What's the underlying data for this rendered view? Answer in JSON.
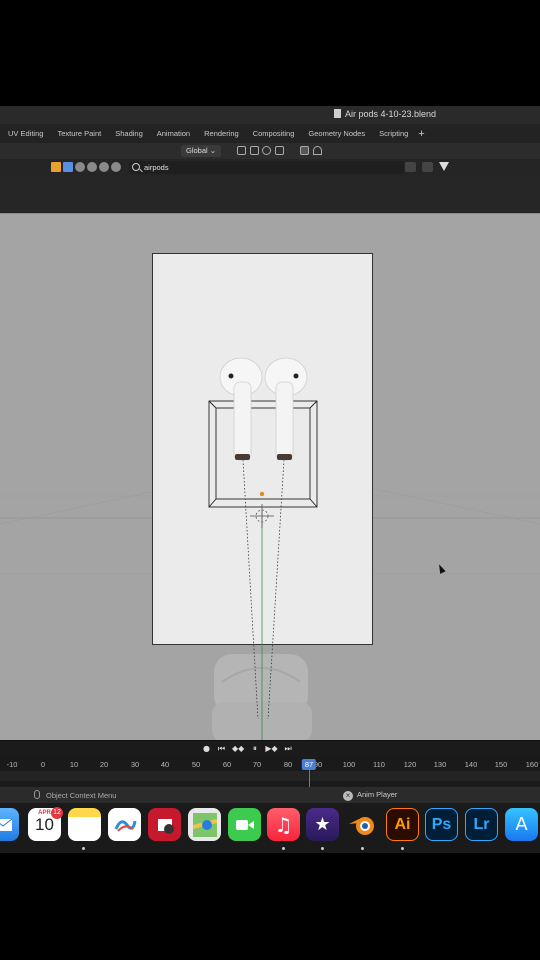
{
  "window": {
    "title": "Air pods 4-10-23.blend"
  },
  "workspaces": [
    "UV Editing",
    "Texture Paint",
    "Shading",
    "Animation",
    "Rendering",
    "Compositing",
    "Geometry Nodes",
    "Scripting"
  ],
  "workspace_add": "+",
  "header": {
    "transform_orientation": "Global ⌄"
  },
  "outliner": {
    "search_value": "airpods"
  },
  "timeline": {
    "ticks": [
      "-10",
      "0",
      "10",
      "20",
      "30",
      "40",
      "50",
      "60",
      "70",
      "80",
      "90",
      "100",
      "110",
      "120",
      "130",
      "140",
      "150",
      "160"
    ],
    "current_frame": "87"
  },
  "playback_controls": [
    "●",
    "⏮",
    "◆◆",
    "⏸",
    "▶◆",
    "⏭"
  ],
  "status": {
    "left": "Object Context Menu",
    "right": "Anim Player"
  },
  "dock": {
    "calendar_month": "APR",
    "calendar_day": "10",
    "mail_badge": "12",
    "photoshop_label": "Ps",
    "lightroom_label": "Lr",
    "illustrator_label": "Ai"
  },
  "colors": {
    "accent_blue": "#4a7fd6",
    "active_orange": "#c77d2a",
    "viewport_grey": "#a4a4a4"
  }
}
